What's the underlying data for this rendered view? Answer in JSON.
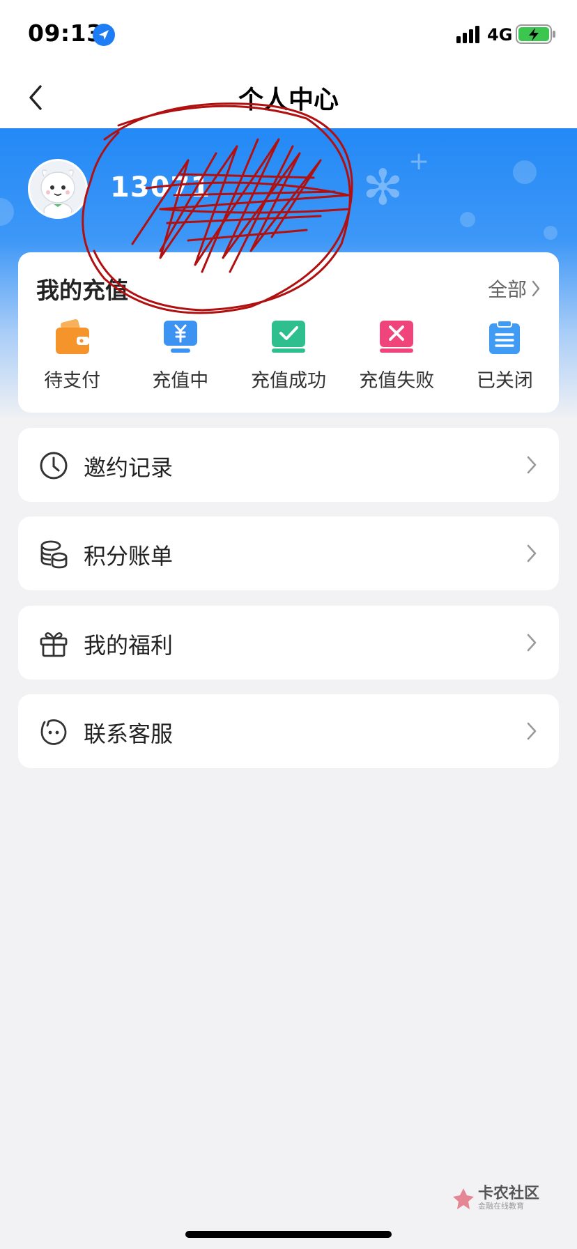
{
  "status_bar": {
    "time": "09:13",
    "network": "4G"
  },
  "nav": {
    "title": "个人中心",
    "back_icon": "chevron-left-icon"
  },
  "profile": {
    "phone_partial": "13071",
    "avatar_icon": "cartoon-avatar"
  },
  "recharge": {
    "title": "我的充值",
    "view_all": "全部",
    "statuses": [
      {
        "label": "待支付",
        "icon": "wallet-icon",
        "color": "#f5942a"
      },
      {
        "label": "充值中",
        "icon": "yuan-icon",
        "color": "#3d93f2"
      },
      {
        "label": "充值成功",
        "icon": "check-icon",
        "color": "#2fbf8e"
      },
      {
        "label": "充值失败",
        "icon": "cross-icon",
        "color": "#f0457a"
      },
      {
        "label": "已关闭",
        "icon": "clipboard-icon",
        "color": "#3f9bf3"
      }
    ]
  },
  "menu": [
    {
      "label": "邀约记录",
      "icon": "clock-icon"
    },
    {
      "label": "积分账单",
      "icon": "coins-icon"
    },
    {
      "label": "我的福利",
      "icon": "gift-icon"
    },
    {
      "label": "联系客服",
      "icon": "service-face-icon"
    }
  ],
  "watermark": {
    "main": "卡农社区",
    "sub": "金融在线教育"
  },
  "colors": {
    "header_blue": "#2389f6",
    "scribble": "#b01010"
  }
}
